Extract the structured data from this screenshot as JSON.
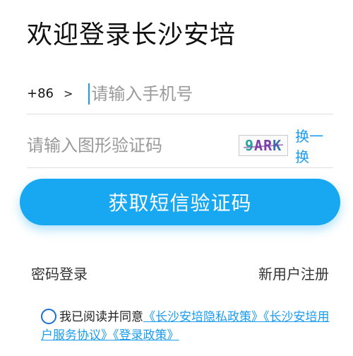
{
  "page_title": "欢迎登录长沙安培",
  "phone": {
    "country_code": "+86",
    "chevron": ">",
    "placeholder": "请输入手机号",
    "value": ""
  },
  "captcha": {
    "placeholder": "请输入图形验证码",
    "image_chars": [
      "9",
      "A",
      "R",
      "K"
    ],
    "refresh_label": "换一换"
  },
  "submit_label": "获取短信验证码",
  "links": {
    "password_login": "密码登录",
    "register": "新用户注册"
  },
  "agreement": {
    "prefix": "我已阅读并同意",
    "policy_1": "《长沙安培隐私政策》",
    "policy_2": "《长沙安培用户服务协议》",
    "policy_3": "《登录政策》",
    "checked": false
  },
  "colors": {
    "accent": "#17a8f1",
    "link": "#1a9cf0",
    "radio": "#1a6fd6"
  }
}
